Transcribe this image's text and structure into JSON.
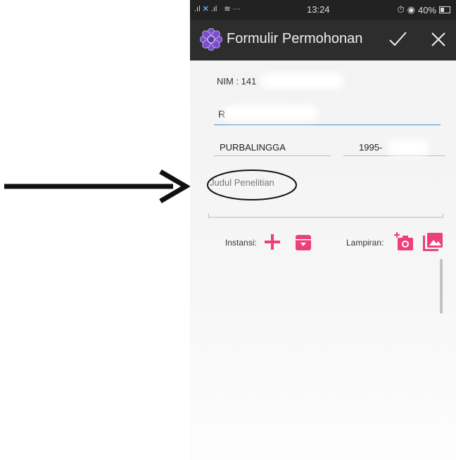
{
  "status_bar": {
    "time": "13:24",
    "battery_percent": "40%",
    "more_dots": "···",
    "carrier_badge": "",
    "battery_level": 0.4
  },
  "app_bar": {
    "title": "Formulir Permohonan",
    "icons": {
      "app": "flower-icon",
      "confirm": "checkmark-icon",
      "close": "close-icon"
    }
  },
  "form": {
    "nim_label": "NIM : 141",
    "name_value": "R",
    "birthplace_value": "PURBALINGGA",
    "birthdate_value": "1995-",
    "research_title_placeholder": "Judul Penelitian",
    "instansi_label": "Instansi:",
    "lampiran_label": "Lampiran:"
  },
  "colors": {
    "accent_pink": "#ec3f7c",
    "input_underline_active": "#4a8ec9",
    "app_bar_bg": "#2d2d2d",
    "status_bar_bg": "#222222",
    "app_icon_purple": "#7b4fc9"
  }
}
